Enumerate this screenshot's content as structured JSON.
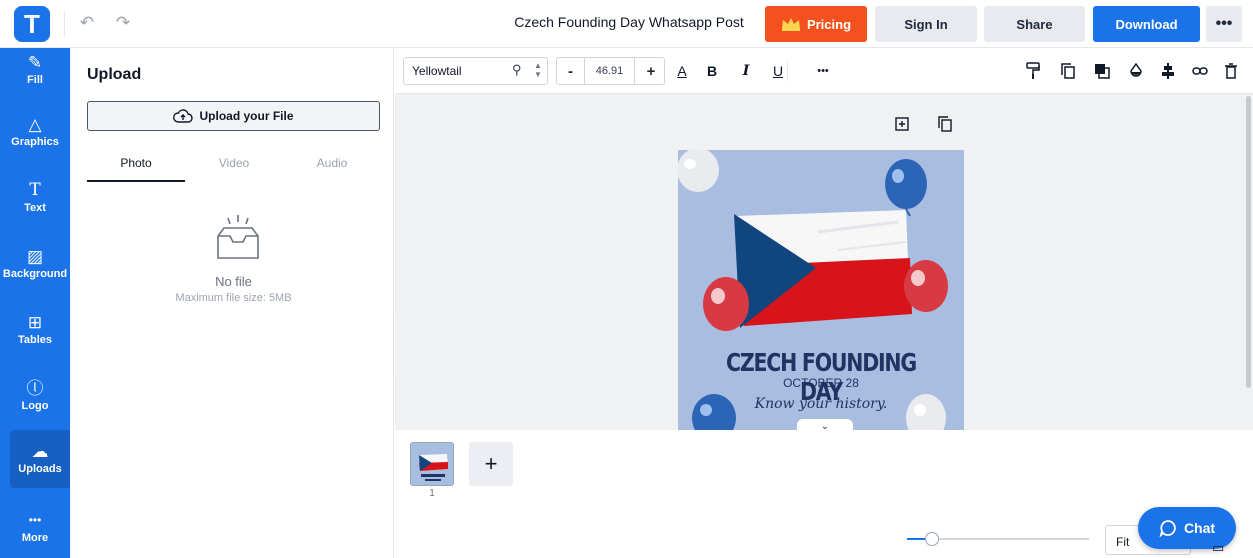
{
  "app": {
    "logo_letter": "T",
    "doc_title": "Czech Founding Day Whatsapp Post",
    "brand_color": "#1a73e8"
  },
  "topbar": {
    "pricing_label": "Pricing",
    "signin_label": "Sign In",
    "share_label": "Share",
    "download_label": "Download",
    "more_label": "•••"
  },
  "sidebar": {
    "items": [
      {
        "label": "Fill",
        "icon": "✎"
      },
      {
        "label": "Graphics",
        "icon": "△"
      },
      {
        "label": "Text",
        "icon": "T"
      },
      {
        "label": "Background",
        "icon": "▨"
      },
      {
        "label": "Tables",
        "icon": "⊞"
      },
      {
        "label": "Logo",
        "icon": "ⓛ"
      },
      {
        "label": "Uploads",
        "icon": "☁"
      },
      {
        "label": "More",
        "icon": "•••"
      }
    ],
    "active": "Uploads"
  },
  "upload_panel": {
    "title": "Upload",
    "upload_button": "Upload your File",
    "tabs": [
      "Photo",
      "Video",
      "Audio"
    ],
    "active_tab": "Photo",
    "empty_title": "No file",
    "empty_subtitle": "Maximum file size: 5MB"
  },
  "toolbar": {
    "font_family": "Yellowtail",
    "font_size": "46.91",
    "minus": "-",
    "plus": "+",
    "bold": "B",
    "italic": "I",
    "underline": "U",
    "more": "•••"
  },
  "design": {
    "headline": "CZECH FOUNDING DAY",
    "date": "OCTOBER 28",
    "tagline": "Know your history.",
    "colors": {
      "background": "#a9bde0",
      "flag_blue": "#11457e",
      "flag_red": "#d7141a",
      "flag_white": "#f7f7f7",
      "text": "#1f3463"
    }
  },
  "pages": {
    "current": "1",
    "add_label": "+"
  },
  "zoom": {
    "mode": "Fit",
    "level": 0.1
  },
  "chat": {
    "label": "Chat"
  }
}
